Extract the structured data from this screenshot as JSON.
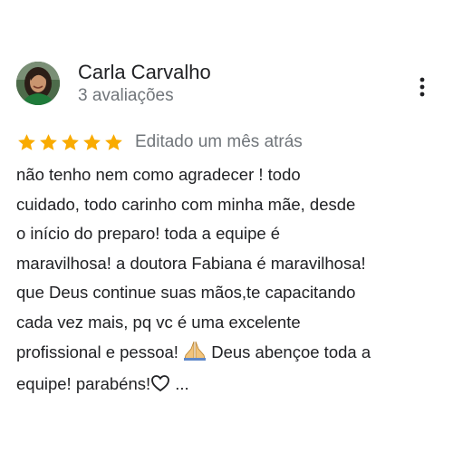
{
  "review": {
    "author": {
      "name": "Carla Carvalho",
      "meta": "3 avaliações",
      "avatar_icon": "user-photo"
    },
    "rating": {
      "stars": 5,
      "max_stars": 5,
      "star_color": "#f9ab00"
    },
    "date": "Editado um mês atrás",
    "more_icon": "vertical-dots-icon",
    "text_lines": [
      "não tenho nem como agradecer ! todo",
      "cuidado, todo carinho com minha mãe, desde",
      "o início do preparo! toda a equipe é",
      "maravilhosa! a doutora Fabiana é maravilhosa!",
      "que Deus continue suas mãos,te capacitando",
      "cada vez mais, pq vc é uma excelente",
      "profissional e pessoa!",
      "Deus abençoe toda a",
      "equipe! parabéns!",
      "..."
    ],
    "emoji": {
      "praying_hands": "praying-hands-icon",
      "heart": "white-heart-icon"
    }
  }
}
